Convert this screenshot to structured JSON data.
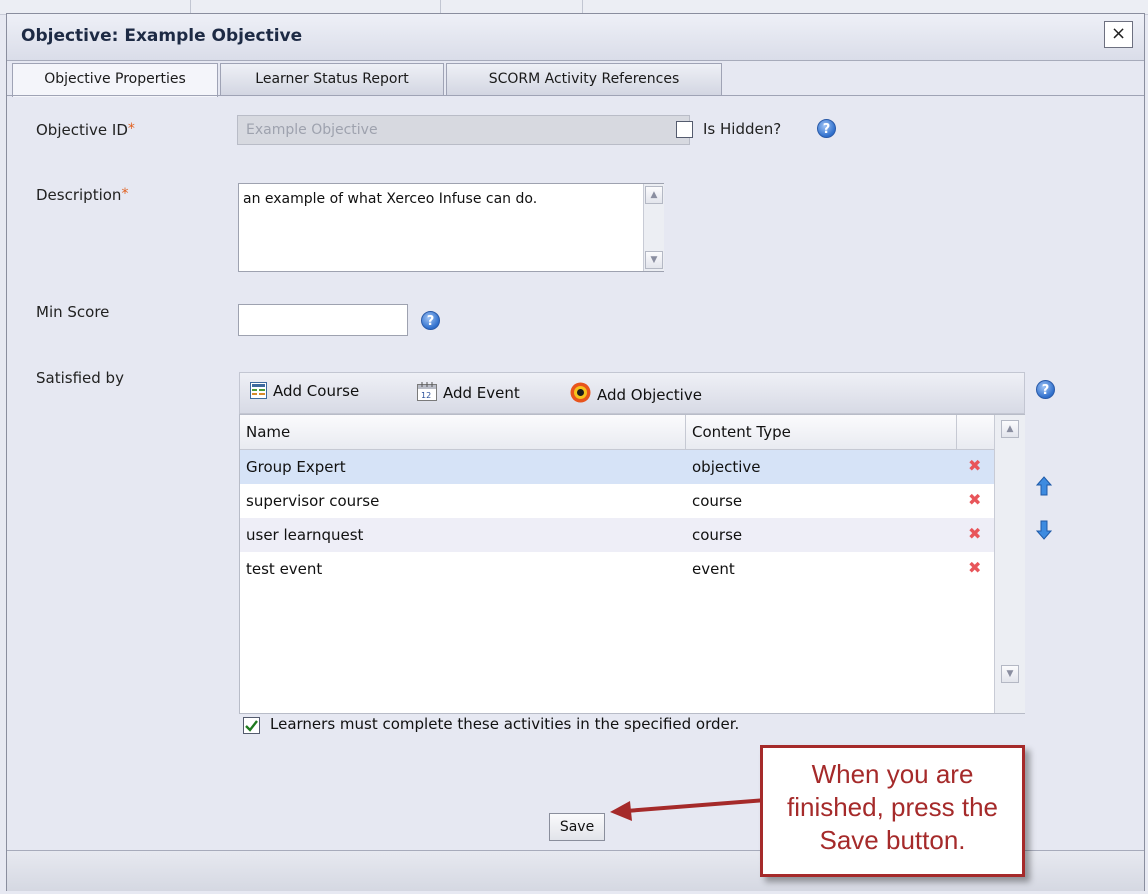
{
  "dialog": {
    "title": "Objective: Example Objective",
    "close_label": "×"
  },
  "tabs": [
    {
      "label": "Objective Properties",
      "active": true
    },
    {
      "label": "Learner Status Report",
      "active": false
    },
    {
      "label": "SCORM Activity References",
      "active": false
    }
  ],
  "form": {
    "objective_id_label": "Objective ID",
    "objective_id_value": "Example Objective",
    "required_marker": "*",
    "is_hidden_label": "Is Hidden?",
    "is_hidden_checked": false,
    "description_label": "Description",
    "description_value": "an example of what Xerceo Infuse can do.",
    "min_score_label": "Min Score",
    "min_score_value": "",
    "satisfied_by_label": "Satisfied by",
    "help_glyph": "?"
  },
  "grid": {
    "toolbar": {
      "add_course": "Add Course",
      "add_event": "Add Event",
      "add_objective": "Add Objective"
    },
    "columns": [
      "Name",
      "Content Type"
    ],
    "rows": [
      {
        "name": "Group Expert",
        "type": "objective"
      },
      {
        "name": "supervisor course",
        "type": "course"
      },
      {
        "name": "user learnquest",
        "type": "course"
      },
      {
        "name": "test event",
        "type": "event"
      }
    ],
    "delete_glyph": "✖"
  },
  "order": {
    "label": "Learners must complete these activities in the specified order.",
    "checked": true
  },
  "save_label": "Save",
  "callout": {
    "text": "When you are finished, press the Save button."
  },
  "colors": {
    "callout": "#a52a2a",
    "selected_row": "#d6e3f7",
    "alt_row": "#eeeef7",
    "required": "#e06020"
  }
}
